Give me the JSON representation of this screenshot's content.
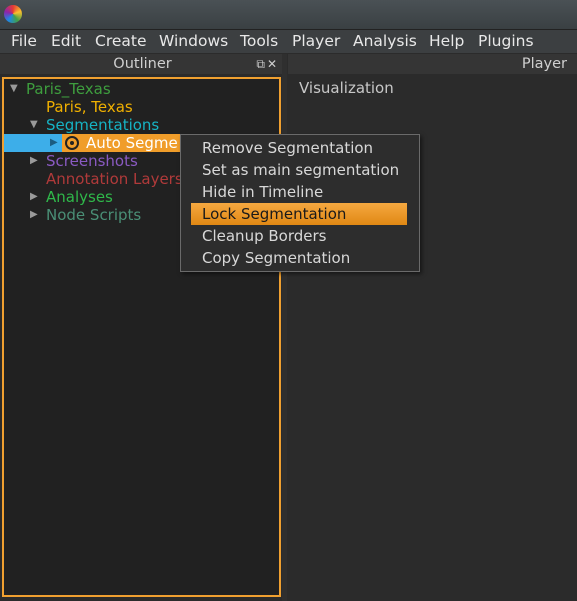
{
  "menubar": {
    "items": [
      "File",
      "Edit",
      "Create",
      "Windows",
      "Tools",
      "Player",
      "Analysis",
      "Help",
      "Plugins"
    ]
  },
  "outliner": {
    "title": "Outliner",
    "tree": [
      {
        "label": "Paris_Texas",
        "color": "#3e9e3e",
        "expanded": true
      },
      {
        "label": "Paris, Texas",
        "color": "#f0b000"
      },
      {
        "label": "Segmentations",
        "color": "#16b3c4",
        "expanded": true
      },
      {
        "label": "Auto Segme",
        "color": "#ffffff",
        "selected": true
      },
      {
        "label": "Screenshots",
        "color": "#8a5ac2",
        "expanded": false
      },
      {
        "label": "Annotation Layers",
        "color": "#b03a3a"
      },
      {
        "label": "Analyses",
        "color": "#2fb84a",
        "expanded": false
      },
      {
        "label": "Node Scripts",
        "color": "#4a8f76",
        "expanded": false
      }
    ]
  },
  "player": {
    "title": "Player",
    "visualization_label": "Visualization"
  },
  "context_menu": {
    "items": [
      {
        "label": "Remove Segmentation",
        "active": false
      },
      {
        "label": "Set as main segmentation",
        "active": false
      },
      {
        "label": "Hide in Timeline",
        "active": false
      },
      {
        "label": "Lock Segmentation",
        "active": true
      },
      {
        "label": "Cleanup Borders",
        "active": false
      },
      {
        "label": "Copy Segmentation",
        "active": false
      }
    ]
  },
  "colors": {
    "accent_orange": "#f09d2a",
    "selection_blue": "#3daee9"
  }
}
